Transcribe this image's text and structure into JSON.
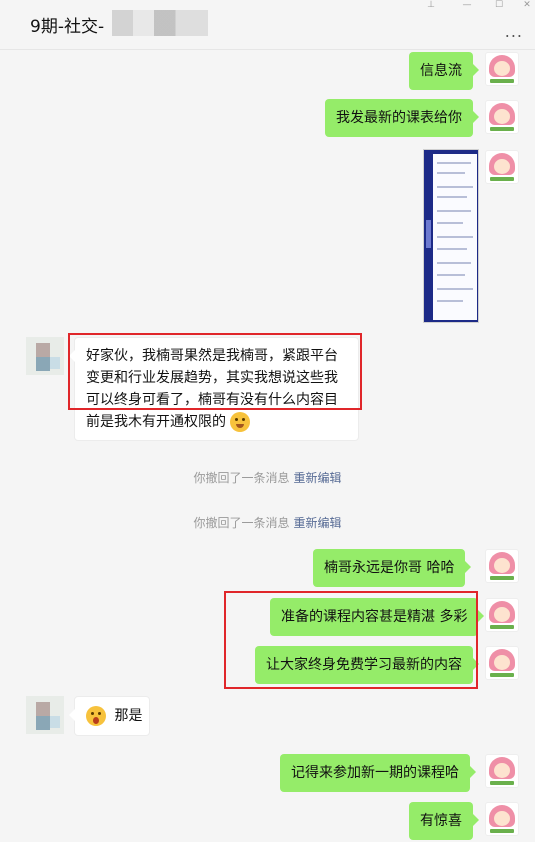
{
  "header": {
    "title": "9期-社交-",
    "more_label": "...",
    "win_pin": "⊥",
    "win_min": "—",
    "win_max": "☐",
    "win_close": "✕"
  },
  "messages": [
    {
      "text": "信息流"
    },
    {
      "text": "我发最新的课表给你"
    },
    {
      "text": "好家伙，我楠哥果然是我楠哥，紧跟平台变更和行业发展趋势，其实我想说这些我可以终身可看了，楠哥有没有什么内容目前是我木有开通权限的"
    },
    {
      "text": "楠哥永远是你哥  哈哈"
    },
    {
      "text": "准备的课程内容甚是精湛 多彩"
    },
    {
      "text": "让大家终身免费学习最新的内容"
    },
    {
      "text": "那是"
    },
    {
      "text": "记得来参加新一期的课程哈"
    },
    {
      "text": "有惊喜"
    }
  ],
  "system": [
    {
      "text": "你撤回了一条消息",
      "link": "重新编辑"
    },
    {
      "text": "你撤回了一条消息",
      "link": "重新编辑"
    }
  ],
  "colors": {
    "bubble_self": "#95ec69",
    "bubble_other": "#ffffff",
    "highlight": "#e0262a",
    "link": "#576b95"
  }
}
